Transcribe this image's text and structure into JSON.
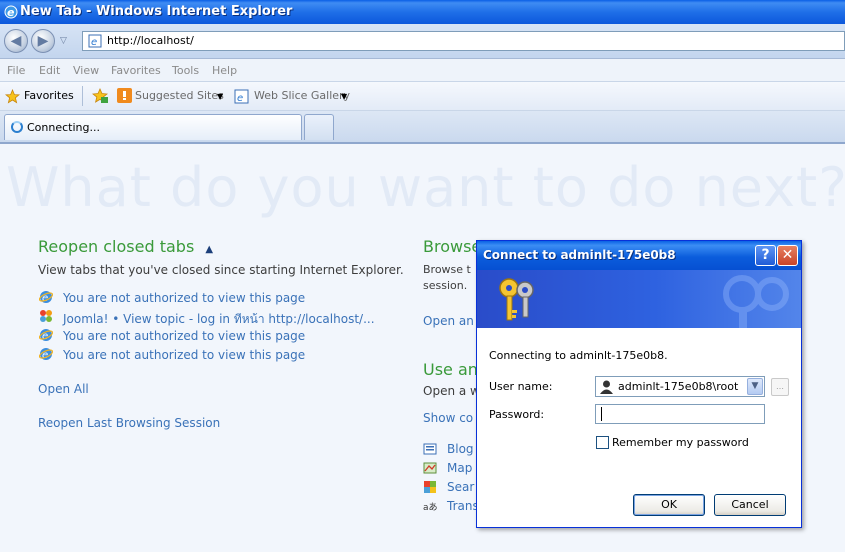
{
  "window": {
    "title": "New Tab - Windows Internet Explorer"
  },
  "address": {
    "url": "http://localhost/"
  },
  "menu": [
    "File",
    "Edit",
    "View",
    "Favorites",
    "Tools",
    "Help"
  ],
  "favorites_bar": {
    "favorites_label": "Favorites",
    "suggested_sites": "Suggested Sites",
    "web_slice_gallery": "Web Slice Gallery"
  },
  "tabs": [
    {
      "label": "Connecting..."
    }
  ],
  "newtab": {
    "heading": "What do you want to do next?",
    "reopen": {
      "title": "Reopen closed tabs",
      "description": "View tabs that you've closed since starting Internet Explorer.",
      "items": [
        "You are not authorized to view this page",
        "Joomla! • View topic - log in ทีหน้า http://localhost/...",
        "You are not authorized to view this page",
        "You are not authorized to view this page"
      ],
      "open_all": "Open All",
      "reopen_last": "Reopen Last Browsing Session"
    },
    "browse": {
      "title": "Browse",
      "description_line1": "Browse t",
      "description_line2": "session.",
      "link": "Open an"
    },
    "use": {
      "title": "Use an",
      "description": "Open a w",
      "show": "Show co",
      "items": [
        "Blog",
        "Map",
        "Sear",
        "Trans"
      ]
    }
  },
  "dialog": {
    "title": "Connect to adminlt-175e0b8",
    "connecting_text": "Connecting to adminlt-175e0b8.",
    "username_label": "User name:",
    "username_value": "adminlt-175e0b8\\root",
    "password_label": "Password:",
    "password_value": "",
    "remember_label": "Remember my password",
    "ok_label": "OK",
    "cancel_label": "Cancel",
    "help_glyph": "?",
    "close_glyph": "✕"
  }
}
